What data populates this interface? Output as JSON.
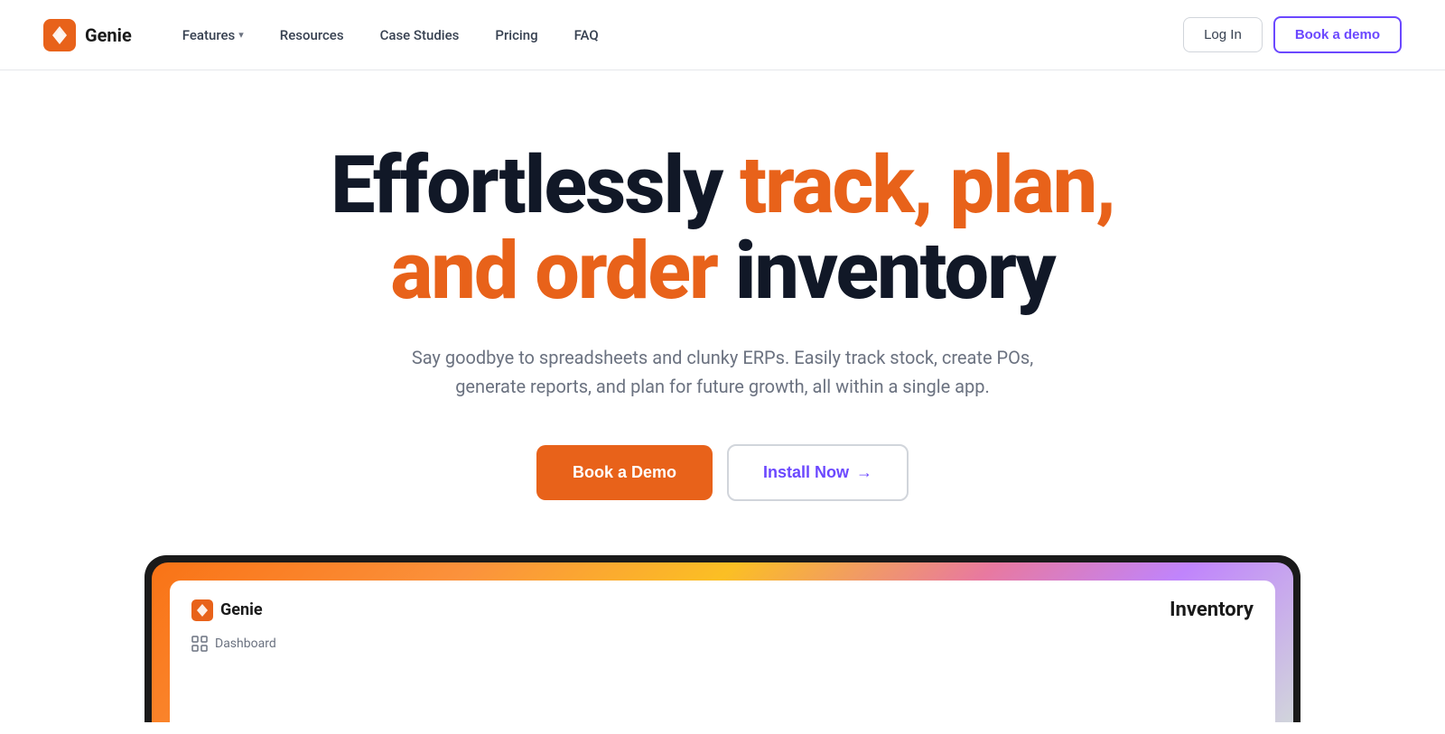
{
  "brand": {
    "name": "Genie",
    "logo_alt": "Genie logo"
  },
  "navbar": {
    "features_label": "Features",
    "resources_label": "Resources",
    "case_studies_label": "Case Studies",
    "pricing_label": "Pricing",
    "faq_label": "FAQ",
    "login_label": "Log In",
    "book_demo_label": "Book a demo"
  },
  "hero": {
    "title_part1": "Effortlessly ",
    "title_orange": "track, plan,",
    "title_part2": "and order",
    "title_black": " inventory",
    "subtitle": "Say goodbye to spreadsheets and clunky ERPs. Easily track stock, create POs, generate reports, and plan for future growth, all within a single app.",
    "book_demo_label": "Book a Demo",
    "install_now_label": "Install Now",
    "arrow": "→"
  },
  "app_preview": {
    "logo_text": "Genie",
    "title": "Inventory",
    "sidebar_item": "Dashboard",
    "sidebar_icon": "grid"
  },
  "colors": {
    "orange": "#e8621a",
    "purple": "#6b48ff",
    "dark": "#111827",
    "gray": "#6b7280",
    "border": "#d1d5db"
  }
}
